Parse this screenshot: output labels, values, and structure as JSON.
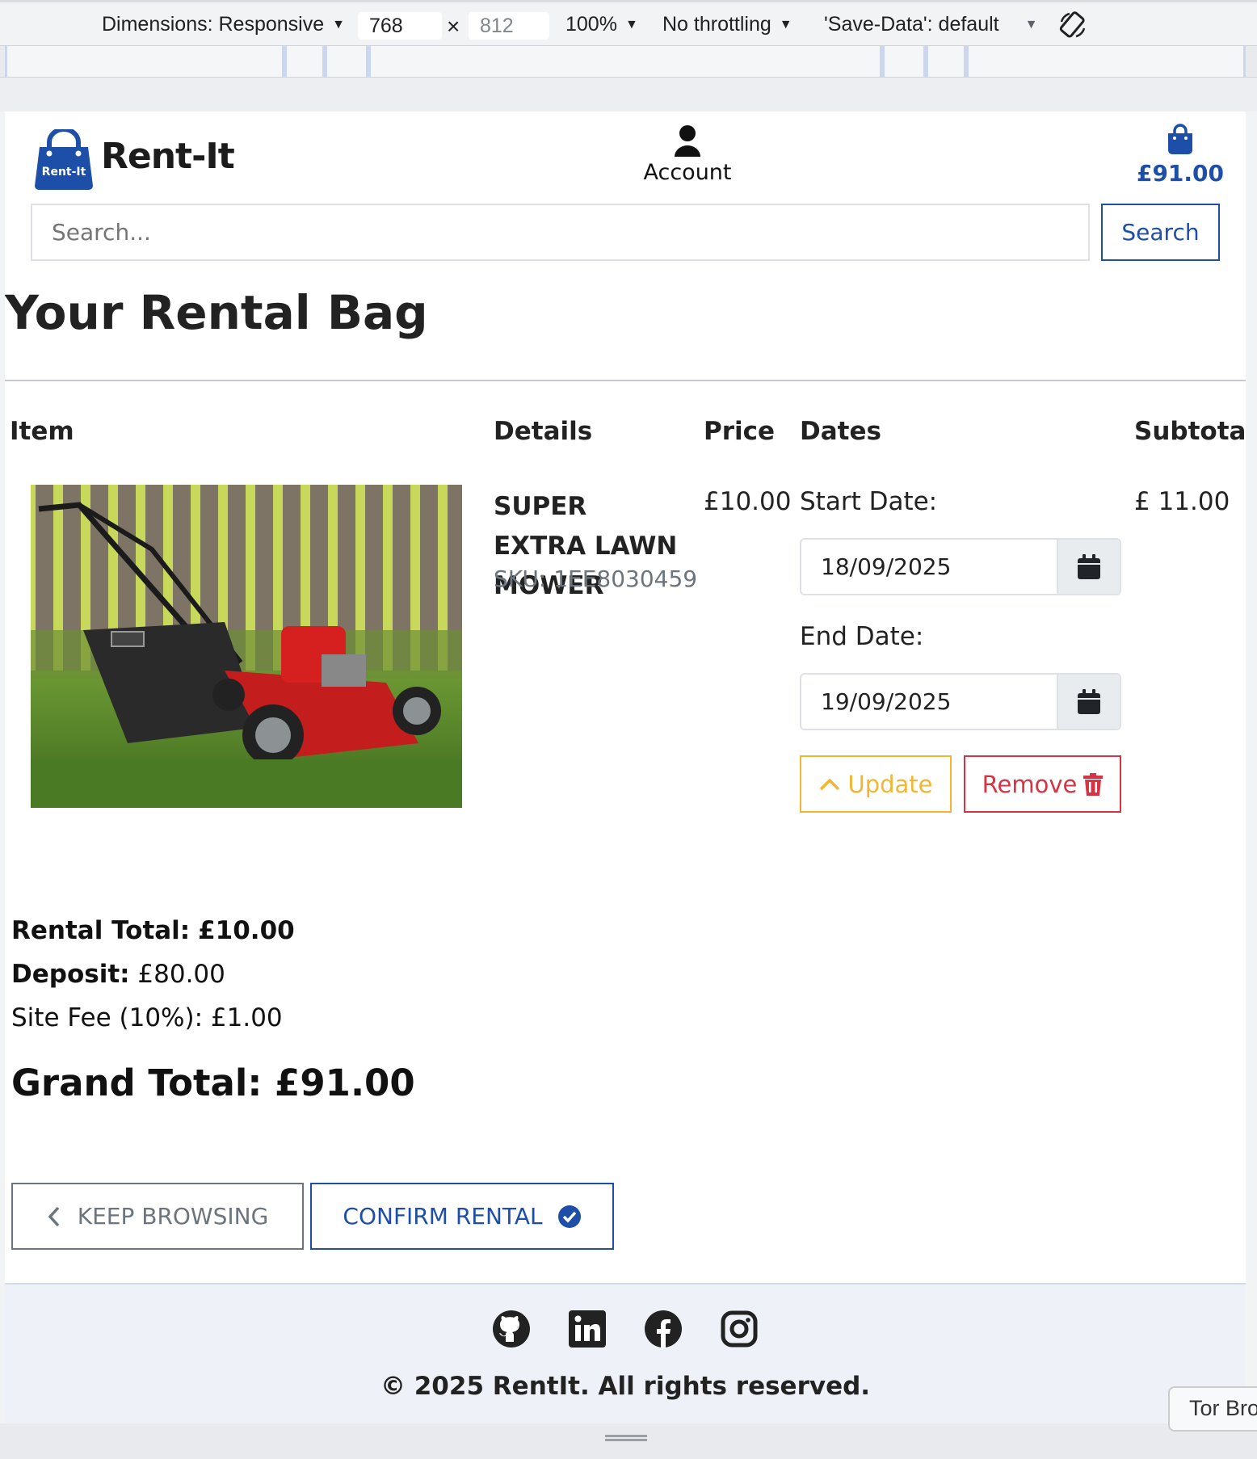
{
  "devtools": {
    "dimensions_label": "Dimensions: Responsive",
    "width": "768",
    "height": "812",
    "zoom": "100%",
    "throttling": "No throttling",
    "save_data": "'Save-Data': default"
  },
  "header": {
    "logo_text": "Rent-It",
    "brand": "Rent-It",
    "account_label": "Account",
    "bag_total": "£91.00"
  },
  "search": {
    "placeholder": "Search...",
    "button_label": "Search"
  },
  "page_title": "Your Rental Bag",
  "table": {
    "headers": {
      "item": "Item",
      "details": "Details",
      "price": "Price",
      "dates": "Dates",
      "subtotal": "Subtotal"
    },
    "row": {
      "name": "SUPER EXTRA LAWN MOWER",
      "sku": "SKU: 1EE8030459",
      "price": "£10.00",
      "start_label": "Start Date:",
      "start_date": "18/09/2025",
      "end_label": "End Date:",
      "end_date": "19/09/2025",
      "update_label": "Update",
      "remove_label": "Remove",
      "subtotal": "£ 11.00"
    }
  },
  "totals": {
    "rental_label": "Rental Total:",
    "rental_value": "£10.00",
    "deposit_label": "Deposit:",
    "deposit_value": "£80.00",
    "site_fee": "Site Fee (10%): £1.00",
    "grand_total": "Grand Total: £91.00"
  },
  "actions": {
    "keep_browsing": "KEEP BROWSING",
    "confirm_rental": "CONFIRM RENTAL"
  },
  "footer": {
    "social_icons": [
      "github-icon",
      "linkedin-icon",
      "facebook-icon",
      "instagram-icon"
    ],
    "copyright": "© 2025 RentIt. All rights reserved."
  },
  "tooltip": "Tor Bro",
  "colors": {
    "primary": "#1e4fa8",
    "warning": "#f2b632",
    "danger": "#d63345",
    "secondary": "#6c757d"
  }
}
